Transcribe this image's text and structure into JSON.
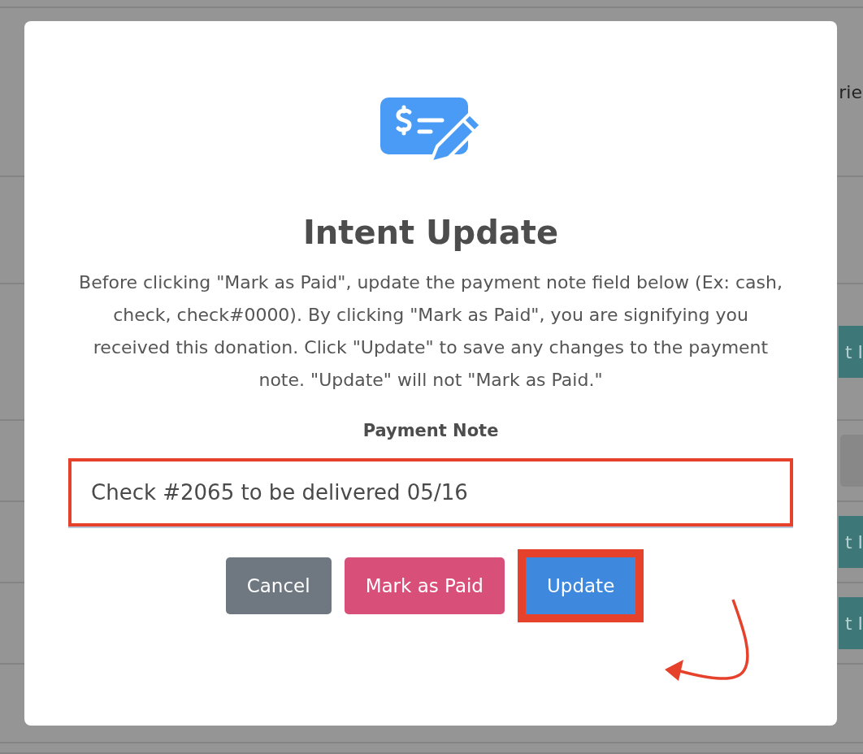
{
  "background": {
    "fragments": [
      {
        "kind": "text",
        "label": "rie"
      },
      {
        "kind": "teal",
        "label": "t I"
      },
      {
        "kind": "grey"
      },
      {
        "kind": "teal",
        "label": "t I"
      },
      {
        "kind": "teal",
        "label": "t I"
      }
    ]
  },
  "dialog": {
    "title": "Intent Update",
    "message": "Before clicking \"Mark as Paid\", update the payment note field below (Ex: cash, check, check#0000). By clicking \"Mark as Paid\", you are signifying you received this donation. Click \"Update\" to save any changes to the payment note. \"Update\" will not \"Mark as Paid.\"",
    "field": {
      "label": "Payment Note",
      "value": "Check #2065 to be delivered 05/16",
      "highlighted": true
    },
    "buttons": [
      {
        "label": "Cancel",
        "kind": "secondary",
        "highlighted": false
      },
      {
        "label": "Mark as Paid",
        "kind": "danger",
        "highlighted": false
      },
      {
        "label": "Update",
        "kind": "primary",
        "highlighted": true
      }
    ]
  }
}
